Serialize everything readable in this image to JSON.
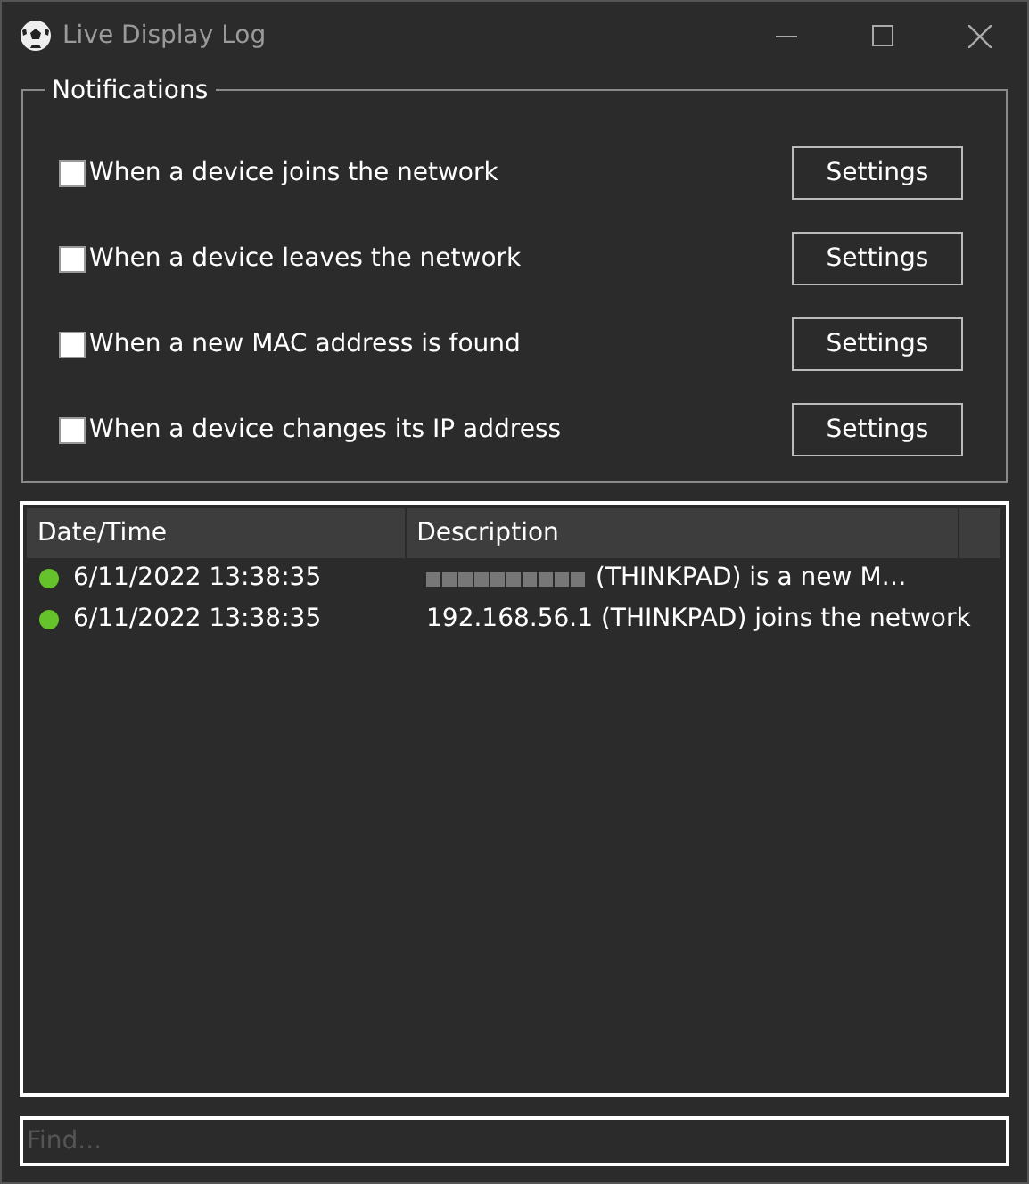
{
  "window": {
    "title": "Live Display Log"
  },
  "notifications": {
    "title": "Notifications",
    "items": [
      {
        "label": "When a device joins the network",
        "checked": false,
        "button": "Settings"
      },
      {
        "label": "When a device leaves the network",
        "checked": false,
        "button": "Settings"
      },
      {
        "label": "When a new MAC address is found",
        "checked": false,
        "button": "Settings"
      },
      {
        "label": "When a device changes its IP address",
        "checked": false,
        "button": "Settings"
      }
    ]
  },
  "log": {
    "columns": [
      "Date/Time",
      "Description"
    ],
    "rows": [
      {
        "color": "#66c22a",
        "datetime": "6/11/2022 13:38:35",
        "redacted": true,
        "description": "(THINKPAD) is a new M…"
      },
      {
        "color": "#66c22a",
        "datetime": "6/11/2022 13:38:35",
        "redacted": false,
        "description": "192.168.56.1 (THINKPAD) joins the network"
      }
    ]
  },
  "find": {
    "placeholder": "Find..."
  }
}
